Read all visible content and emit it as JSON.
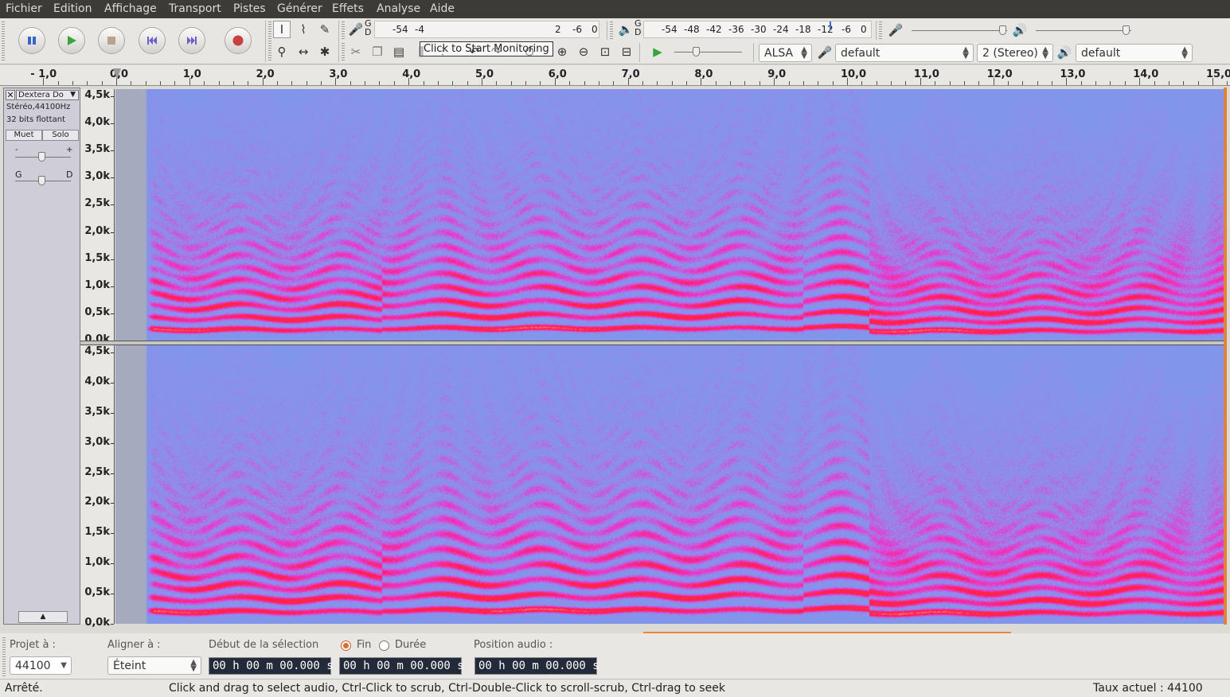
{
  "menu": [
    "Fichier",
    "Edition",
    "Affichage",
    "Transport",
    "Pistes",
    "Générer",
    "Effets",
    "Analyse",
    "Aide"
  ],
  "transport": {
    "pause": "pause",
    "play": "play",
    "stop": "stop",
    "skip_start": "skip-to-start",
    "skip_end": "skip-to-end",
    "record": "record"
  },
  "recording_meter": {
    "gd": "G\nD",
    "ticks": [
      "-54",
      "-4"
    ],
    "ticks_right": [
      "2",
      "-6",
      "0"
    ]
  },
  "tooltip": "Click to Start Monitoring",
  "playback_meter": {
    "gd": "G\nD",
    "ticks": [
      "-54",
      "-48",
      "-42",
      "-36",
      "-30",
      "-24",
      "-18",
      "-12",
      "-6",
      "0"
    ]
  },
  "device": {
    "host": "ALSA",
    "rec_device": "default",
    "channels": "2 (Stereo)",
    "play_device": "default"
  },
  "ruler": {
    "ticks": [
      "- 1,0",
      "0,0",
      "1,0",
      "2,0",
      "3,0",
      "4,0",
      "5,0",
      "6,0",
      "7,0",
      "8,0",
      "9,0",
      "10,0",
      "11,0",
      "12,0",
      "13,0",
      "14,0",
      "15,0"
    ]
  },
  "track": {
    "name": "Dextera Do",
    "format": "Stéréo,44100Hz",
    "bits": "32 bits flottant",
    "mute": "Muet",
    "solo": "Solo",
    "gain_minus": "-",
    "gain_plus": "+",
    "pan_left": "G",
    "pan_right": "D",
    "collapse": "▲"
  },
  "freq_labels": [
    "4,5k",
    "4,0k",
    "3,5k",
    "3,0k",
    "2,5k",
    "2,0k",
    "1,5k",
    "1,0k",
    "0,5k",
    "0,0k"
  ],
  "spectrogram_colors": {
    "background": "#7d9ff0",
    "mid": "#e040e0",
    "high": "#ff2050",
    "peak": "#ffffff",
    "silence": "#a9aec0"
  },
  "status": {
    "project_label": "Projet à :",
    "project_rate": "44100",
    "align_label": "Aligner à :",
    "align_value": "Éteint",
    "selection_label": "Début de la sélection",
    "end_label": "Fin",
    "duration_label": "Durée",
    "audio_pos_label": "Position audio :",
    "sel_start": "00 h 00 m 00.000 s",
    "sel_end": "00 h 00 m 00.000 s",
    "audio_pos": "00 h 00 m 00.000 s",
    "state": "Arrêté.",
    "hint": "Click and drag to select audio, Ctrl-Click to scrub, Ctrl-Double-Click to scroll-scrub, Ctrl-drag to seek",
    "rate": "Taux actuel : 44100"
  }
}
